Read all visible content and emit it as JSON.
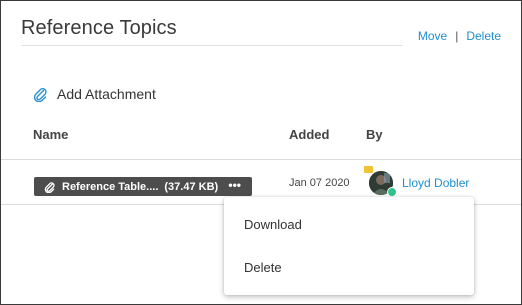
{
  "header": {
    "title": "Reference Topics",
    "move_label": "Move",
    "separator": "|",
    "delete_label": "Delete"
  },
  "toolbar": {
    "add_attachment_label": "Add Attachment",
    "icon": "paperclip-icon"
  },
  "table": {
    "columns": [
      "Name",
      "Added",
      "By"
    ],
    "rows": [
      {
        "file_name": "Reference Table....",
        "file_size": "(37.47 KB)",
        "more_label": "•••",
        "added": "Jan 07 2020",
        "by": "Lloyd Dobler"
      }
    ]
  },
  "context_menu": {
    "items": [
      "Download",
      "Delete"
    ]
  },
  "colors": {
    "link": "#1f8ecf",
    "chip_bg": "#4d4d4d",
    "status_online": "#2fc48d",
    "badge": "#f1c232"
  }
}
